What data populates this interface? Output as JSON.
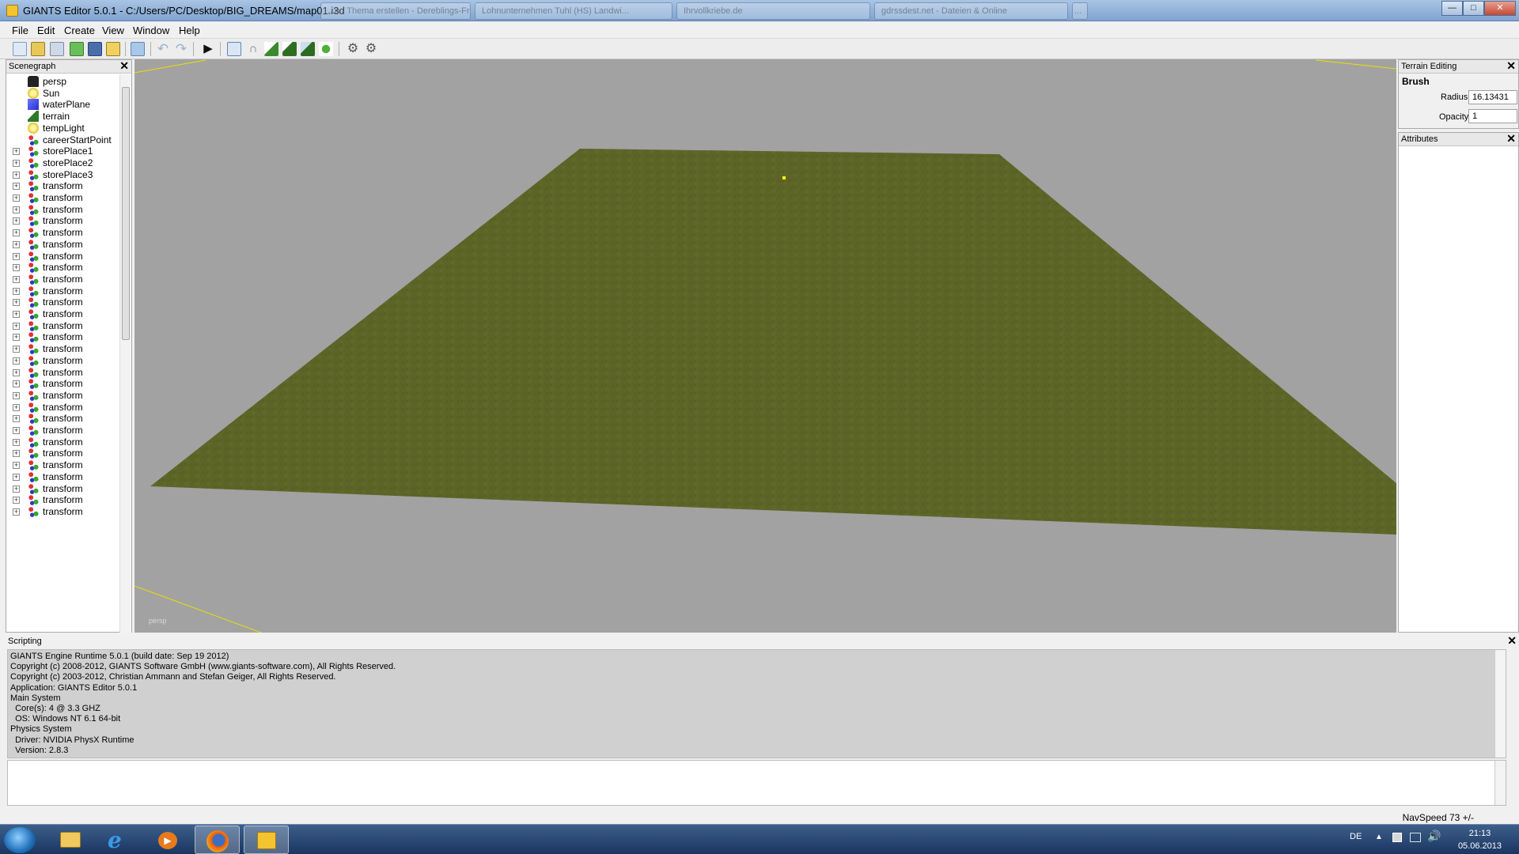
{
  "window": {
    "title": "GIANTS Editor 5.0.1 - C:/Users/PC/Desktop/BIG_DREAMS/map01.i3d",
    "background_tabs": [
      "...n / Thema erstellen - Dereblings-Fr...",
      "Lohnunternehmen Tuhl (HS) Landwi...",
      "Ihrvollkriebe.de",
      "gdrssdest.net - Dateien & Online",
      "..."
    ],
    "controls": {
      "minimize": "—",
      "maximize": "□",
      "close": "✕"
    }
  },
  "menu": [
    "File",
    "Edit",
    "Create",
    "View",
    "Window",
    "Help"
  ],
  "toolbar": {
    "buttons": [
      "new-icon",
      "open-icon",
      "import-icon",
      "reload-icon",
      "save-icon",
      "save-as-icon",
      "revert-icon",
      "undo-icon",
      "redo-icon",
      "play-icon",
      "select-tool-icon",
      "move-tool-icon",
      "terrain-sculpt-icon",
      "terrain-paint-icon",
      "terrain-smooth-icon",
      "foliage-paint-icon",
      "settings-icon",
      "settings-alt-icon"
    ]
  },
  "scenegraph": {
    "title": "Scenegraph",
    "nodes": [
      {
        "label": "persp",
        "icon": "camera",
        "expandable": false
      },
      {
        "label": "Sun",
        "icon": "light",
        "expandable": false
      },
      {
        "label": "waterPlane",
        "icon": "shape",
        "expandable": false
      },
      {
        "label": "terrain",
        "icon": "terrain",
        "expandable": false
      },
      {
        "label": "tempLight",
        "icon": "light",
        "expandable": false
      },
      {
        "label": "careerStartPoint",
        "icon": "transform",
        "expandable": false
      },
      {
        "label": "storePlace1",
        "icon": "transform",
        "expandable": true
      },
      {
        "label": "storePlace2",
        "icon": "transform",
        "expandable": true
      },
      {
        "label": "storePlace3",
        "icon": "transform",
        "expandable": true
      },
      {
        "label": "transform",
        "icon": "transform",
        "expandable": true
      },
      {
        "label": "transform",
        "icon": "transform",
        "expandable": true
      },
      {
        "label": "transform",
        "icon": "transform",
        "expandable": true
      },
      {
        "label": "transform",
        "icon": "transform",
        "expandable": true
      },
      {
        "label": "transform",
        "icon": "transform",
        "expandable": true
      },
      {
        "label": "transform",
        "icon": "transform",
        "expandable": true
      },
      {
        "label": "transform",
        "icon": "transform",
        "expandable": true
      },
      {
        "label": "transform",
        "icon": "transform",
        "expandable": true
      },
      {
        "label": "transform",
        "icon": "transform",
        "expandable": true
      },
      {
        "label": "transform",
        "icon": "transform",
        "expandable": true
      },
      {
        "label": "transform",
        "icon": "transform",
        "expandable": true
      },
      {
        "label": "transform",
        "icon": "transform",
        "expandable": true
      },
      {
        "label": "transform",
        "icon": "transform",
        "expandable": true
      },
      {
        "label": "transform",
        "icon": "transform",
        "expandable": true
      },
      {
        "label": "transform",
        "icon": "transform",
        "expandable": true
      },
      {
        "label": "transform",
        "icon": "transform",
        "expandable": true
      },
      {
        "label": "transform",
        "icon": "transform",
        "expandable": true
      },
      {
        "label": "transform",
        "icon": "transform",
        "expandable": true
      },
      {
        "label": "transform",
        "icon": "transform",
        "expandable": true
      },
      {
        "label": "transform",
        "icon": "transform",
        "expandable": true
      },
      {
        "label": "transform",
        "icon": "transform",
        "expandable": true
      },
      {
        "label": "transform",
        "icon": "transform",
        "expandable": true
      },
      {
        "label": "transform",
        "icon": "transform",
        "expandable": true
      },
      {
        "label": "transform",
        "icon": "transform",
        "expandable": true
      },
      {
        "label": "transform",
        "icon": "transform",
        "expandable": true
      },
      {
        "label": "transform",
        "icon": "transform",
        "expandable": true
      },
      {
        "label": "transform",
        "icon": "transform",
        "expandable": true
      },
      {
        "label": "transform",
        "icon": "transform",
        "expandable": true
      },
      {
        "label": "transform",
        "icon": "transform",
        "expandable": true
      }
    ]
  },
  "viewport": {
    "camera_label": "persp",
    "background_color": "#a2a2a2",
    "terrain_color": "#5b6426"
  },
  "terrain_editing": {
    "title": "Terrain Editing",
    "section": "Brush",
    "radius_label": "Radius",
    "radius_value": "16.13431",
    "opacity_label": "Opacity",
    "opacity_value": "1"
  },
  "attributes": {
    "title": "Attributes"
  },
  "scripting": {
    "title": "Scripting",
    "log": [
      "GIANTS Engine Runtime 5.0.1 (build date: Sep 19 2012)",
      "Copyright (c) 2008-2012, GIANTS Software GmbH (www.giants-software.com), All Rights Reserved.",
      "Copyright (c) 2003-2012, Christian Ammann and Stefan Geiger, All Rights Reserved.",
      "Application: GIANTS Editor 5.0.1",
      "Main System",
      "  Core(s): 4 @ 3.3 GHZ",
      "  OS: Windows NT 6.1 64-bit",
      "Physics System",
      "  Driver: NVIDIA PhysX Runtime",
      "  Version: 2.8.3"
    ]
  },
  "status": {
    "navspeed": "NavSpeed 73 +/-"
  },
  "taskbar": {
    "apps": [
      "start-orb-icon",
      "explorer-icon",
      "internet-explorer-icon",
      "media-player-icon",
      "firefox-icon",
      "giants-editor-icon"
    ],
    "language": "DE",
    "time": "21:13",
    "date": "05.06.2013"
  }
}
